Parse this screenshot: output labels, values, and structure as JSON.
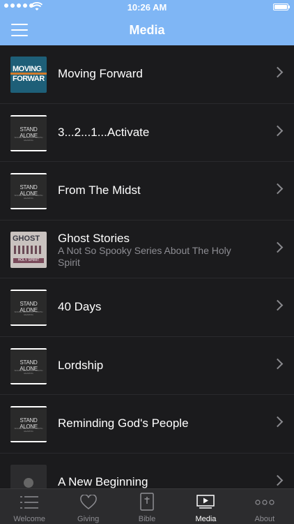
{
  "status": {
    "time": "10:26 AM"
  },
  "nav": {
    "title": "Media"
  },
  "items": [
    {
      "title": "Moving Forward",
      "subtitle": "",
      "thumb": "moving",
      "thumb_text": [
        "MOVING",
        "FORWAR"
      ]
    },
    {
      "title": "3...2...1...Activate",
      "subtitle": "",
      "thumb": "stand",
      "thumb_text": [
        "STAND ALONE",
        "SINGLE SERMONS · WORTH HEARING"
      ]
    },
    {
      "title": "From The Midst",
      "subtitle": "",
      "thumb": "stand",
      "thumb_text": [
        "STAND ALONE",
        "SINGLE SERMONS · WORTH HEARING"
      ]
    },
    {
      "title": "Ghost Stories",
      "subtitle": "A Not So Spooky Series About The Holy Spirit",
      "thumb": "ghost",
      "thumb_text": [
        "GHOST",
        "HOLY SPIRIT"
      ]
    },
    {
      "title": "40 Days",
      "subtitle": "",
      "thumb": "stand",
      "thumb_text": [
        "STAND ALONE",
        "SINGLE SERMONS · WORTH HEARING"
      ]
    },
    {
      "title": "Lordship",
      "subtitle": "",
      "thumb": "stand",
      "thumb_text": [
        "STAND ALONE",
        "SINGLE SERMONS · WORTH HEARING"
      ]
    },
    {
      "title": "Reminding God's People",
      "subtitle": "",
      "thumb": "stand",
      "thumb_text": [
        "STAND ALONE",
        "SINGLE SERMONS · WORTH HEARING"
      ]
    },
    {
      "title": "A New Beginning",
      "subtitle": "",
      "thumb": "logo",
      "thumb_text": []
    }
  ],
  "tabs": [
    {
      "label": "Welcome",
      "icon": "list-icon",
      "active": false
    },
    {
      "label": "Giving",
      "icon": "heart-icon",
      "active": false
    },
    {
      "label": "Bible",
      "icon": "bible-icon",
      "active": false
    },
    {
      "label": "Media",
      "icon": "play-icon",
      "active": true
    },
    {
      "label": "About",
      "icon": "more-icon",
      "active": false
    }
  ],
  "colors": {
    "accent": "#7fb6f5",
    "background": "#1b1b1d",
    "tabbar": "#2c2c2e"
  }
}
